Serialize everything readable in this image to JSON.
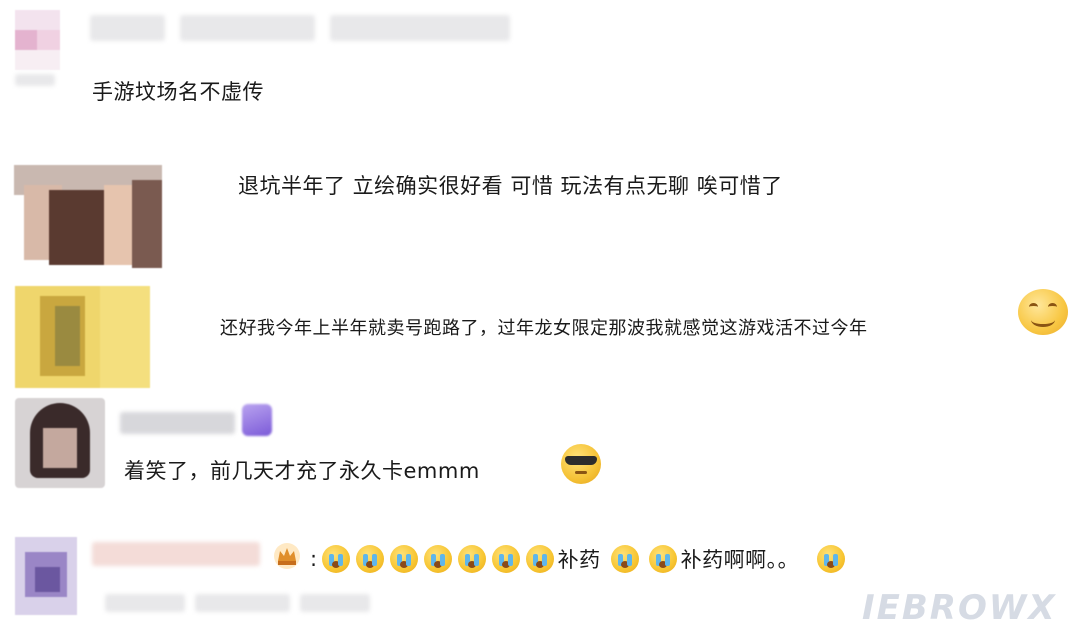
{
  "comments": [
    {
      "text": "手游坟场名不虚传"
    },
    {
      "text": "退坑半年了 立绘确实很好看 可惜 玩法有点无聊 唉可惜了"
    },
    {
      "text": "还好我今年上半年就卖号跑路了，过年龙女限定那波我就感觉这游戏活不过今年",
      "trailing_emoji": "smile-emoji"
    },
    {
      "text": "着笑了，前几天才充了永久卡emmm",
      "trailing_emoji": "cool-sunglasses-emoji"
    },
    {
      "segments": [
        {
          "emoji": "cry-emoji"
        },
        {
          "emoji": "cry-emoji"
        },
        {
          "emoji": "cry-emoji"
        },
        {
          "emoji": "cry-emoji"
        },
        {
          "emoji": "cry-emoji"
        },
        {
          "emoji": "cry-emoji"
        },
        {
          "emoji": "cry-emoji"
        },
        {
          "text": "补药"
        },
        {
          "emoji": "cry-emoji"
        },
        {
          "emoji": "cry-emoji"
        },
        {
          "text": "补药啊啊。。"
        },
        {
          "emoji": "cry-emoji"
        }
      ],
      "prefix": ":"
    }
  ],
  "watermark": "IEBROWX"
}
